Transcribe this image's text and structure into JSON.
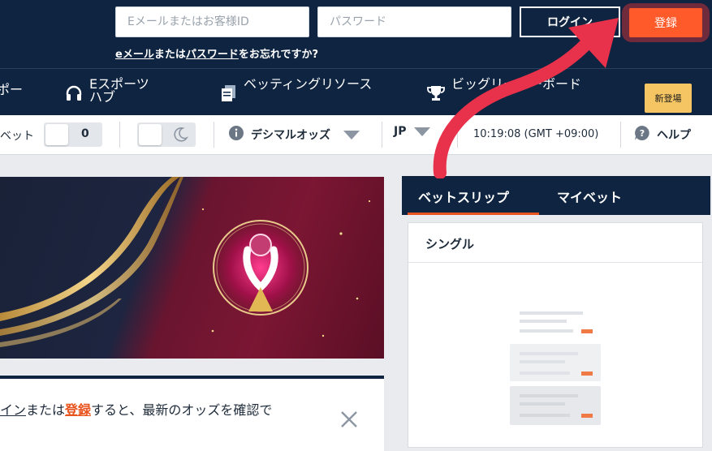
{
  "header": {
    "email_placeholder": "Eメールまたはお客様ID",
    "password_placeholder": "パスワード",
    "login_label": "ログイン",
    "register_label": "登録",
    "forgot": {
      "email_link": "eメール",
      "middle": "または",
      "password_link": "パスワード",
      "suffix": "をお忘れですか?"
    }
  },
  "nav": {
    "items": [
      {
        "label": "ポー",
        "icon": "none"
      },
      {
        "label": "Eスポーツハブ",
        "icon": "headset-icon"
      },
      {
        "label": "ベッティングリソース",
        "icon": "document-icon"
      },
      {
        "label": "ビッグリーダーボード",
        "icon": "trophy-icon"
      }
    ],
    "new_badge": "新登場"
  },
  "settings": {
    "quick_bet_label": "ベット",
    "quick_bet_value": "0",
    "odds_format": "デシマルオッズ",
    "language": "JP",
    "clock": "10:19:08 (GMT +09:00)",
    "help_label": "ヘルプ"
  },
  "promo": {
    "login_link": "イン",
    "middle": "または",
    "register_link": "登録",
    "suffix": "すると、最新のオッズを確認で"
  },
  "betslip": {
    "tabs": [
      "ベットスリップ",
      "マイベット"
    ],
    "active_tab": 0,
    "type_label": "シングル"
  },
  "colors": {
    "navy": "#0e2440",
    "orange": "#ff5a2a",
    "accent": "#e9531d",
    "arrow": "#e8314a"
  }
}
